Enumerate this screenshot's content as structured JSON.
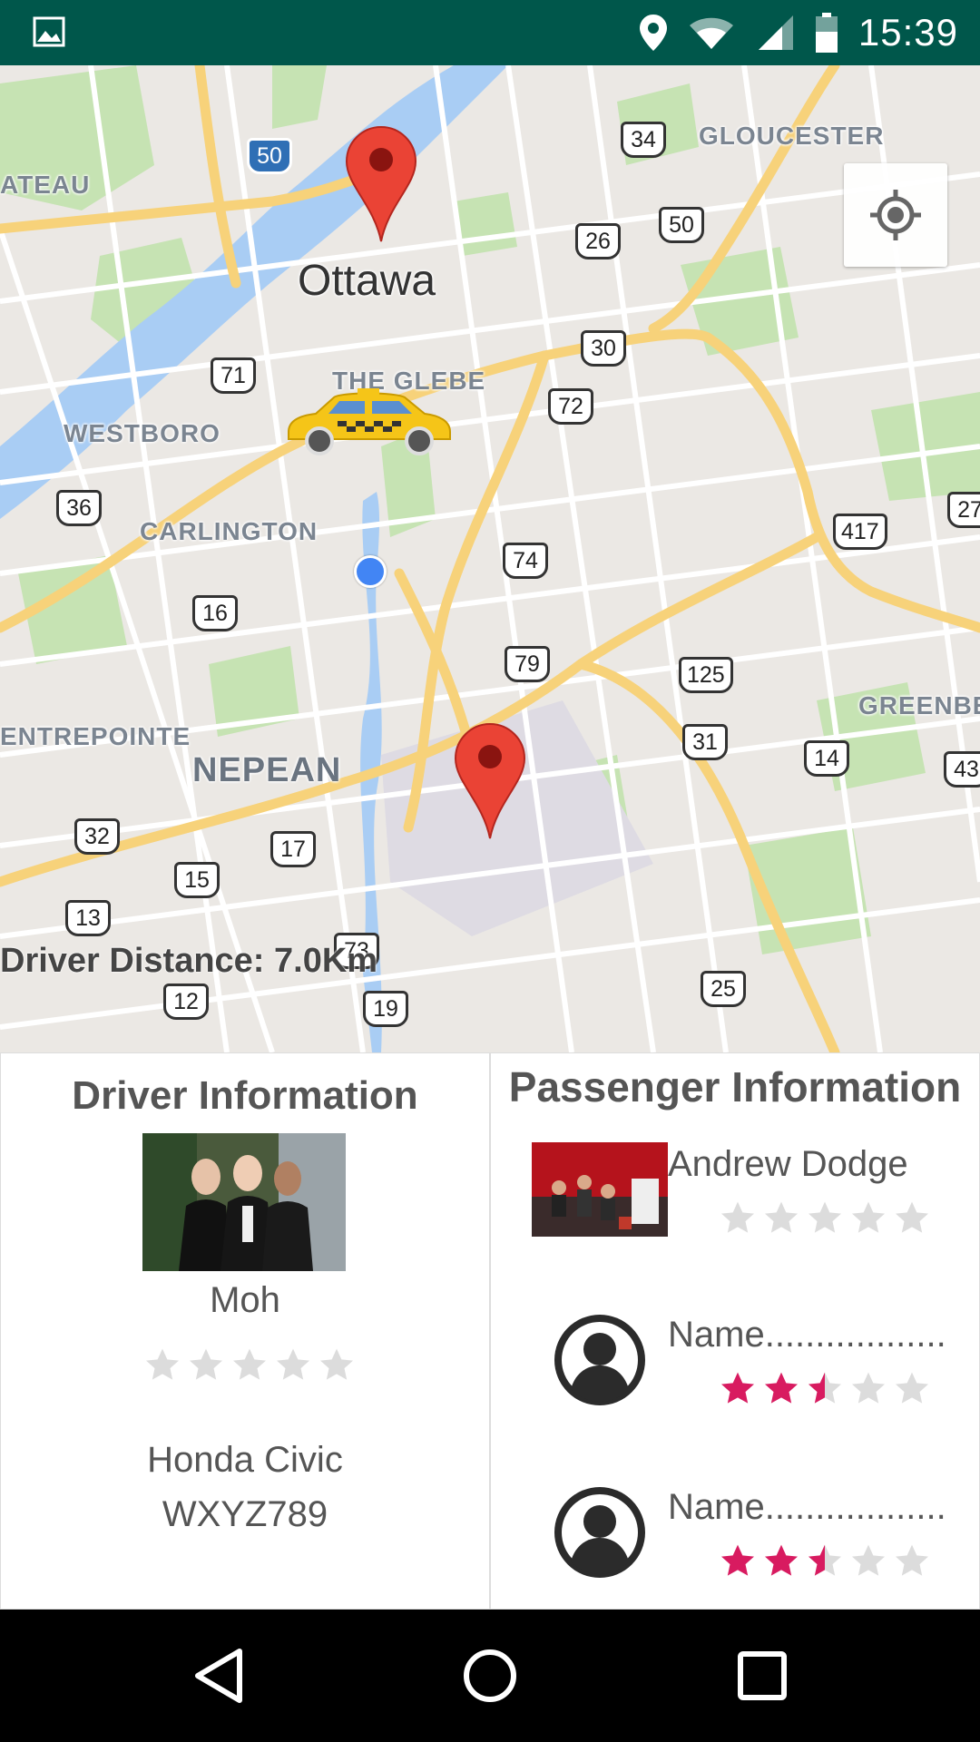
{
  "status_bar": {
    "time": "15:39"
  },
  "map": {
    "places": {
      "ottawa": "Ottawa",
      "gloucester": "GLOUCESTER",
      "ateau": "ATEAU",
      "westboro": "WESTBORO",
      "carlington": "CARLINGTON",
      "the_glebe": "THE GLEBE",
      "nepean": "NEPEAN",
      "entrepointe": "ENTREPOINTE",
      "greenbe": "GREENBE"
    },
    "routes": {
      "r50a": "50",
      "r34": "34",
      "r26": "26",
      "r50b": "50",
      "r71": "71",
      "r30": "30",
      "r72": "72",
      "r36": "36",
      "r74": "74",
      "r417": "417",
      "r27": "27",
      "r16": "16",
      "r79": "79",
      "r125": "125",
      "r31": "31",
      "r14": "14",
      "r43": "43",
      "r32": "32",
      "r17": "17",
      "r15": "15",
      "r13": "13",
      "r73": "73",
      "r25": "25",
      "r12": "12",
      "r19": "19"
    },
    "driver_distance_label": "Driver Distance:",
    "driver_distance_value": "7.0Km"
  },
  "driver": {
    "title": "Driver Information",
    "name": "Moh",
    "rating": 0,
    "car_model": "Honda Civic",
    "plate": "WXYZ789"
  },
  "passenger": {
    "title": "Passenger Information",
    "items": [
      {
        "name": "Andrew Dodge",
        "rating": 0,
        "has_photo": true
      },
      {
        "name": "Name..................",
        "rating": 2.5,
        "has_photo": false
      },
      {
        "name": "Name..................",
        "rating": 2.5,
        "has_photo": false
      }
    ]
  },
  "colors": {
    "status_bar": "#00574b",
    "star_filled": "#d81b60",
    "star_empty": "#dcdcdc",
    "pin": "#ea4335"
  }
}
